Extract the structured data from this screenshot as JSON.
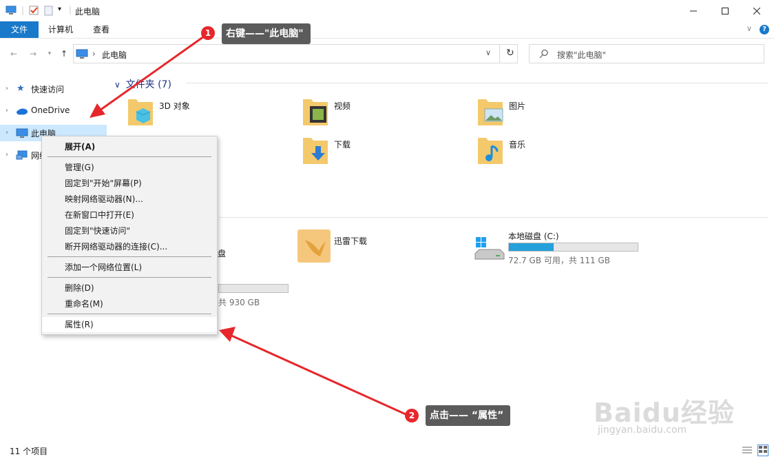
{
  "window": {
    "title": "此电脑"
  },
  "ribbon": {
    "tabs": [
      "文件",
      "计算机",
      "查看"
    ]
  },
  "address": {
    "path": "此电脑"
  },
  "search": {
    "placeholder": "搜索\"此电脑\""
  },
  "nav": {
    "items": [
      "快速访问",
      "OneDrive",
      "此电脑",
      "网络"
    ]
  },
  "folders": {
    "header": "文件夹 (7)",
    "items": [
      "3D 对象",
      "视频",
      "图片",
      "下载",
      "音乐"
    ]
  },
  "devices": {
    "partial_label": "盘",
    "partial_size": "共 930 GB",
    "thunder": "迅雷下载",
    "local_disk": {
      "name": "本地磁盘 (C:)",
      "size": "72.7 GB 可用，共 111 GB",
      "used_fraction": 0.35
    }
  },
  "context_menu": {
    "items": [
      "展开(A)",
      "管理(G)",
      "固定到\"开始\"屏幕(P)",
      "映射网络驱动器(N)...",
      "在新窗口中打开(E)",
      "固定到\"快速访问\"",
      "断开网络驱动器的连接(C)...",
      "添加一个网络位置(L)",
      "删除(D)",
      "重命名(M)",
      "属性(R)"
    ]
  },
  "annotations": {
    "step1_num": "1",
    "step1": "右键——\"此电脑\"",
    "step2_num": "2",
    "step2": "点击—— “属性”"
  },
  "status": {
    "count": "11 个项目"
  },
  "watermark": {
    "brand": "Baidu经验",
    "url": "jingyan.baidu.com"
  },
  "colors": {
    "accent": "#1979ca",
    "annotation_red": "#e6272b",
    "folder": "#f3c96b"
  }
}
